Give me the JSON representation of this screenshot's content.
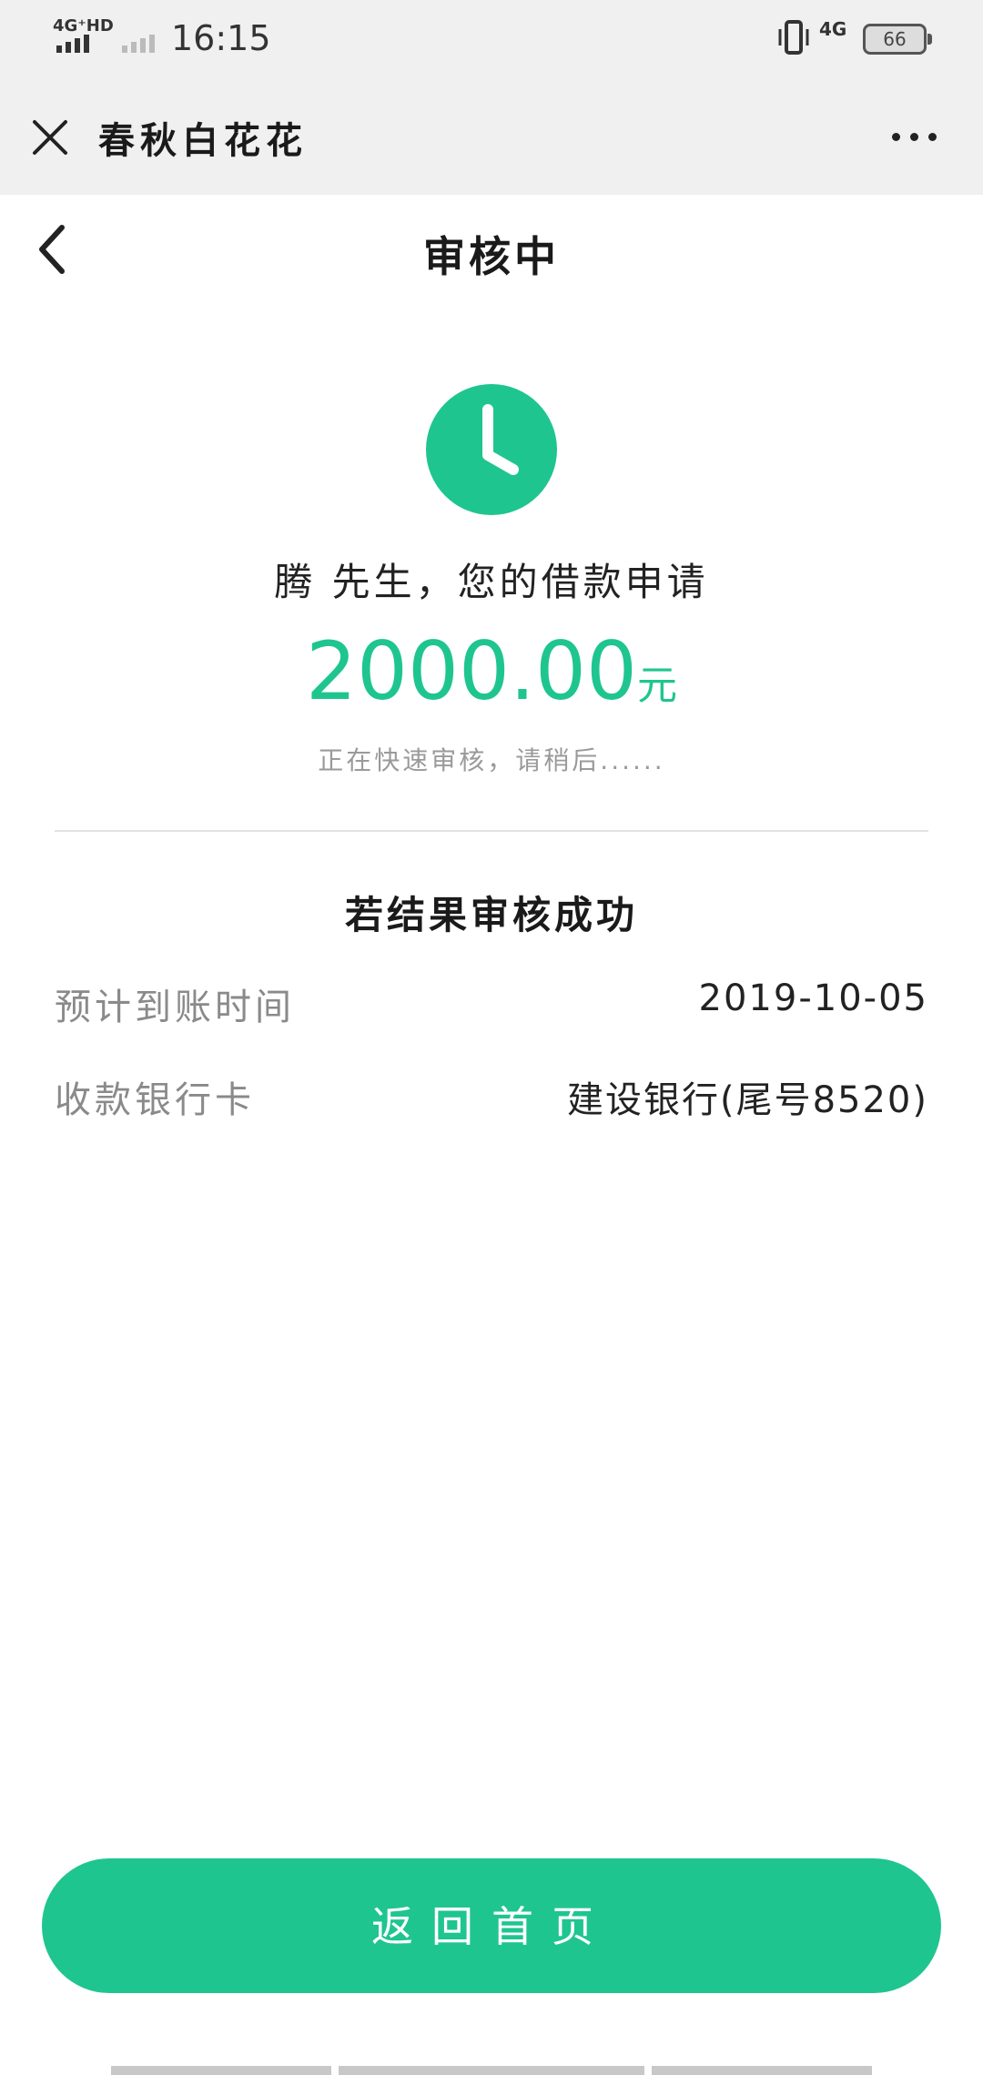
{
  "status_bar": {
    "network_left": "4G⁺HD",
    "time": "16:15",
    "network_right": "4G",
    "battery": "66"
  },
  "app_header": {
    "title": "春秋白花花"
  },
  "page": {
    "title": "审核中"
  },
  "application": {
    "greeting": "腾 先生，您的借款申请",
    "amount": "2000.00",
    "unit": "元",
    "hint": "正在快速审核，请稍后......"
  },
  "result_section": {
    "title": "若结果审核成功",
    "rows": [
      {
        "label": "预计到账时间",
        "value": "2019-10-05"
      },
      {
        "label": "收款银行卡",
        "value": "建设银行(尾号8520)"
      }
    ]
  },
  "footer": {
    "home_button": "返回首页"
  },
  "colors": {
    "accent": "#1fc58f",
    "header_bg": "#f0f0f0"
  },
  "icons": [
    "close-icon",
    "more-icon",
    "back-icon",
    "clock-icon"
  ]
}
